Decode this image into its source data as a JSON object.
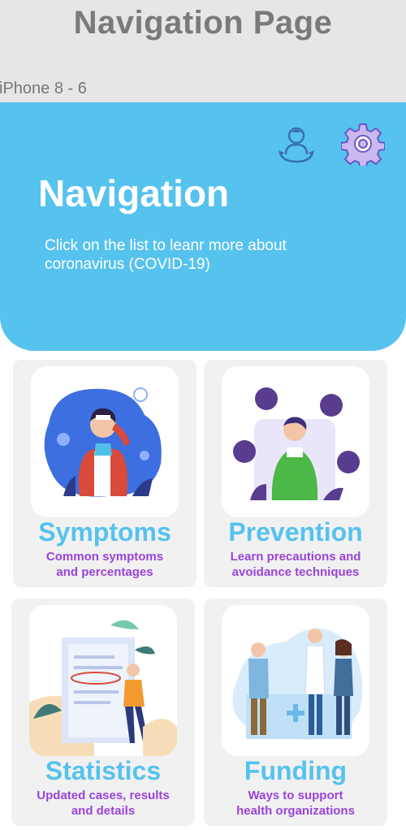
{
  "page": {
    "title": "Navigation Page",
    "frame_label": "iPhone 8 - 6"
  },
  "hero": {
    "title": "Navigation",
    "subtitle": "Click on the list to leanr more about coronavirus (COVID-19)",
    "color": "#56c2ee",
    "icons": [
      "user-switch-icon",
      "gear-icon"
    ]
  },
  "cards": [
    {
      "title": "Symptoms",
      "desc": "Common symptoms\nand percentages"
    },
    {
      "title": "Prevention",
      "desc": "Learn precautions and\navoidance techniques"
    },
    {
      "title": "Statistics",
      "desc": "Updated cases, results\nand details"
    },
    {
      "title": "Funding",
      "desc": "Ways to support\nhealth organizations"
    }
  ],
  "colors": {
    "accent": "#56c2ee",
    "desc_text": "#9a44d6",
    "card_bg": "#f1f1f1",
    "header_bg": "#e6e6e6"
  }
}
